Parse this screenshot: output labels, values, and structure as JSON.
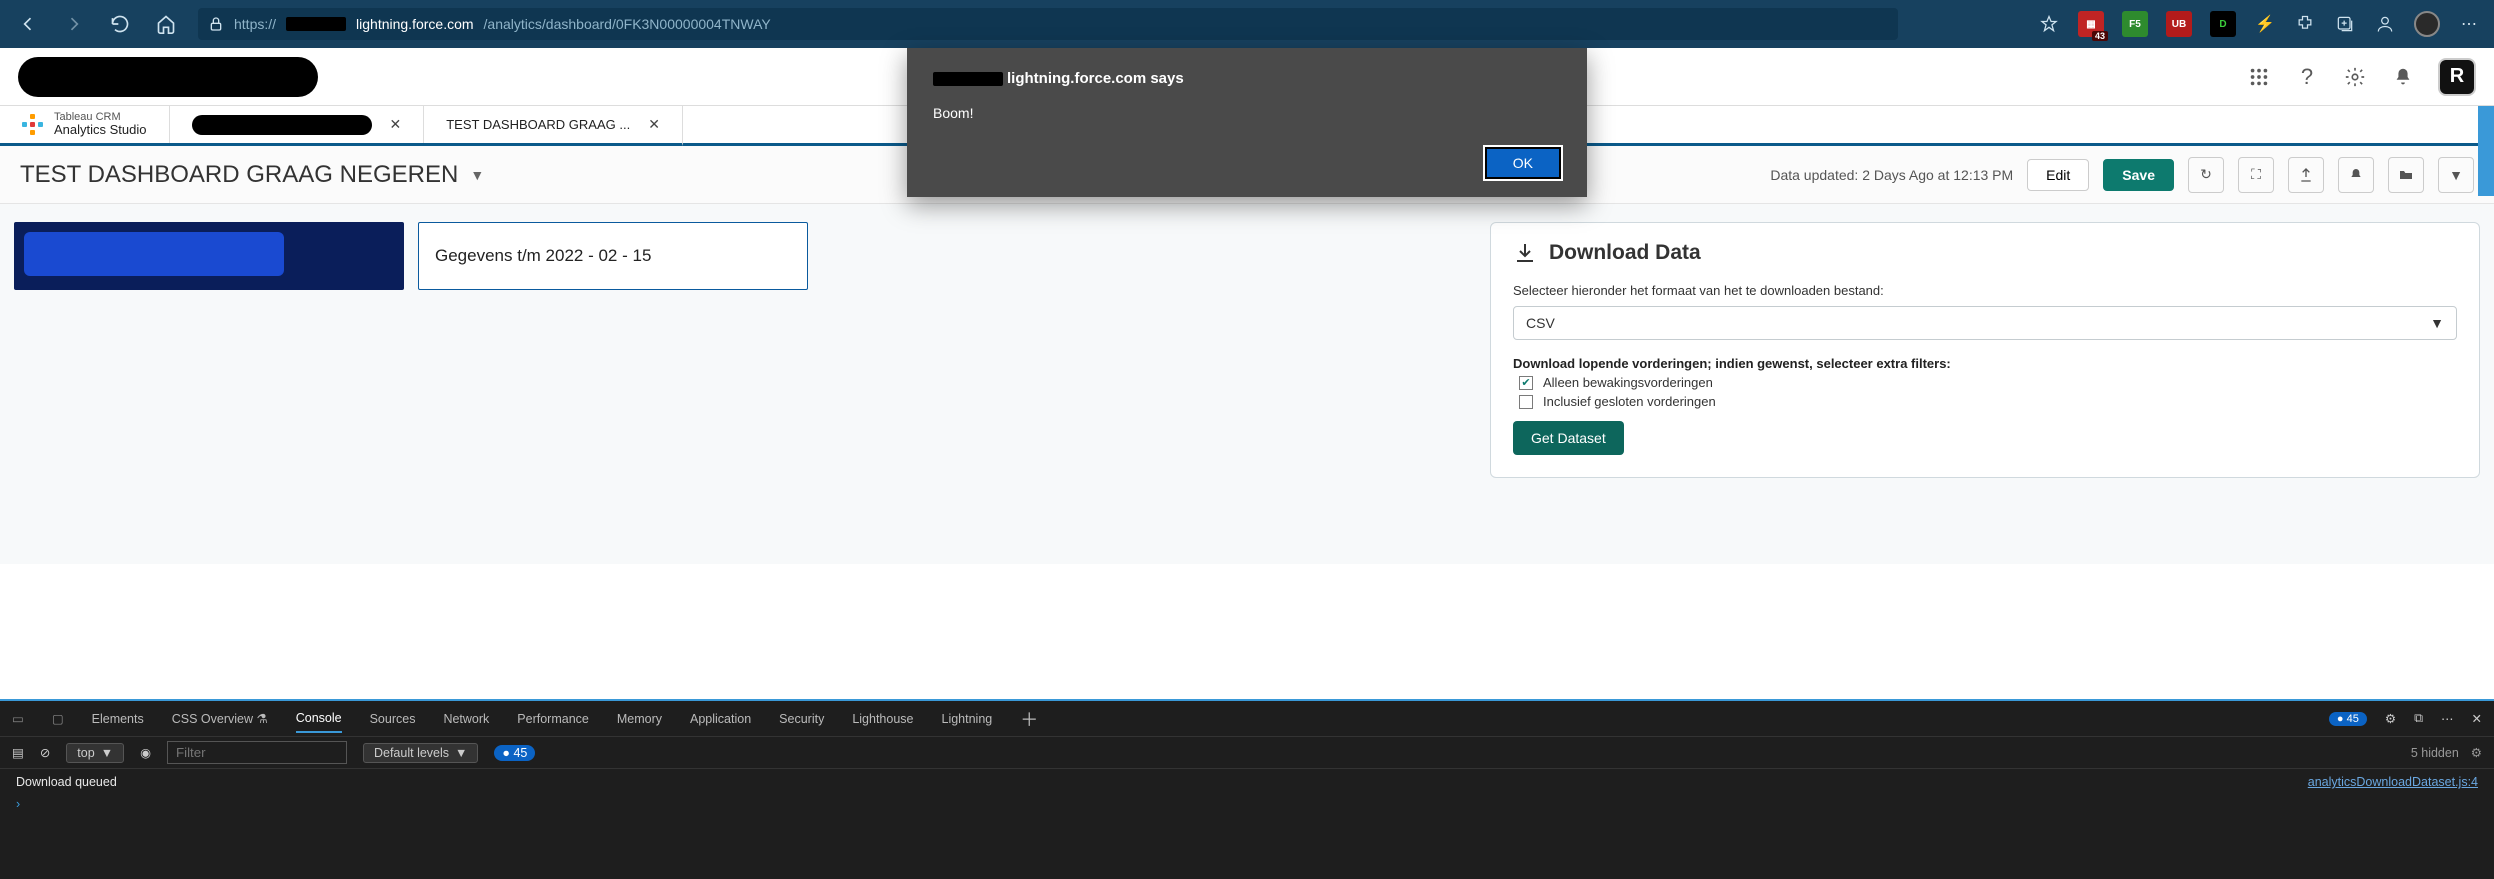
{
  "browser": {
    "protocol": "https://",
    "host_suffix": "lightning.force.com",
    "path": "/analytics/dashboard/0FK3N00000004TNWAY",
    "ext_badge": "43",
    "ext_f5": "F5",
    "ext_ub": "UB"
  },
  "alert": {
    "origin_suffix": "lightning.force.com says",
    "message": "Boom!",
    "ok": "OK"
  },
  "sfHeader": {
    "avatar_initial": "R"
  },
  "tabs": {
    "t1_small": "Tableau CRM",
    "t1_main": "Analytics Studio",
    "t3": "TEST DASHBOARD GRAAG ..."
  },
  "actionBar": {
    "title": "TEST DASHBOARD GRAAG NEGEREN",
    "updated": "Data updated: 2 Days Ago at 12:13 PM",
    "edit": "Edit",
    "save": "Save"
  },
  "canvas": {
    "dateText": "Gegevens t/m 2022 - 02 - 15",
    "download": {
      "heading": "Download Data",
      "selectLabel": "Selecteer hieronder het formaat van het te downloaden bestand:",
      "selectValue": "CSV",
      "bold": "Download lopende vorderingen; indien gewenst, selecteer extra filters:",
      "chk1": "Alleen bewakingsvorderingen",
      "chk2": "Inclusief gesloten vorderingen",
      "button": "Get Dataset"
    }
  },
  "devtools": {
    "tabs": {
      "elements": "Elements",
      "css": "CSS Overview",
      "console": "Console",
      "sources": "Sources",
      "network": "Network",
      "performance": "Performance",
      "memory": "Memory",
      "application": "Application",
      "security": "Security",
      "lighthouse": "Lighthouse",
      "lightning": "Lightning"
    },
    "issues": "45",
    "toolbar": {
      "context": "top",
      "filter_ph": "Filter",
      "levels": "Default levels",
      "count": "45",
      "hidden": "5 hidden"
    },
    "console": {
      "line1": "Download queued",
      "src1": "analyticsDownloadDataset.js:4"
    }
  }
}
